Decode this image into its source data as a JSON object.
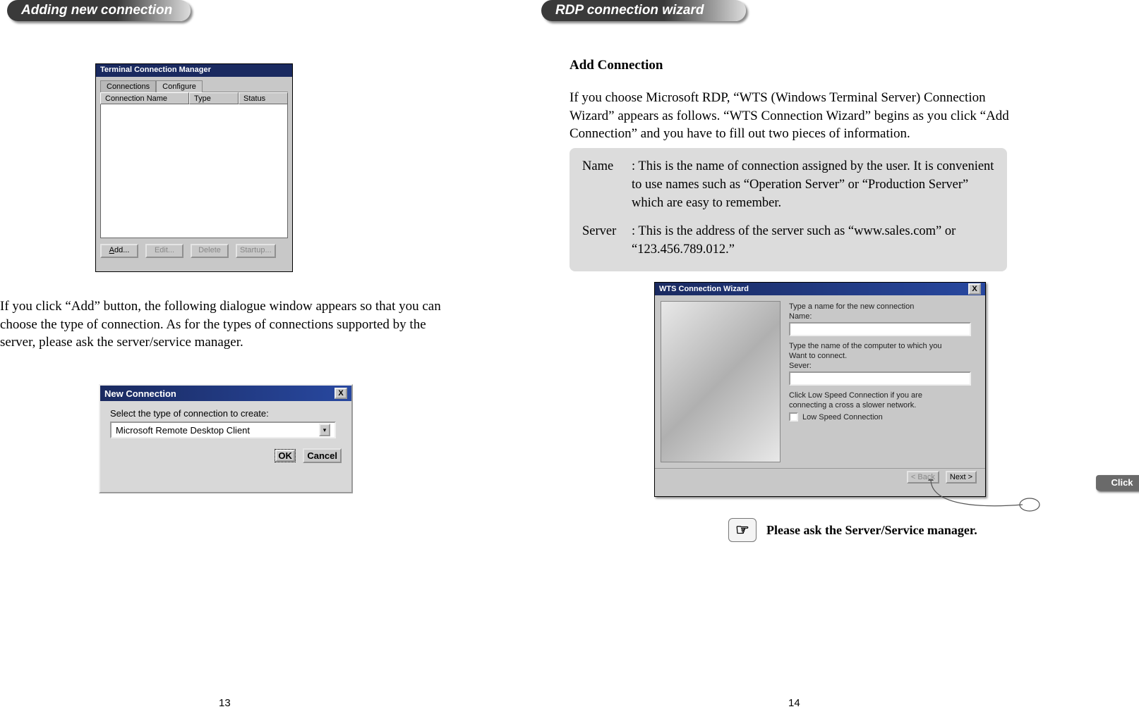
{
  "left": {
    "section_title": "Adding new connection",
    "tcm": {
      "title": "Terminal Connection Manager",
      "tabs": {
        "connections": "Connections",
        "configure": "Configure"
      },
      "cols": {
        "name": "Connection Name",
        "type": "Type",
        "status": "Status"
      },
      "buttons": {
        "add": "Add...",
        "edit": "Edit...",
        "delete": "Delete",
        "startup": "Startup..."
      }
    },
    "para1": "If you click “Add” button, the following dialogue window appears so that you can choose the type of connection. As for the types of connections supported by the server, please ask the server/service manager.",
    "nc": {
      "title": "New Connection",
      "prompt": "Select the type of connection to create:",
      "option": "Microsoft Remote Desktop Client",
      "ok": "OK",
      "cancel": "Cancel"
    },
    "page_num": "13"
  },
  "right": {
    "section_title": "RDP connection wizard",
    "heading": "Add Connection",
    "para1": "If you choose Microsoft RDP, “WTS (Windows Terminal Server) Connection Wizard” appears as follows. “WTS Connection Wizard” begins as you click “Add Connection” and you have to fill out two pieces of information.",
    "info": {
      "name_label": "Name",
      "name_text": ": This is the name of connection assigned by the user. It is convenient to use names such as “Operation Server” or “Production Server” which are easy to remember.",
      "server_label": "Server",
      "server_text": ": This is the address of the server such as “www.sales.com”  or “123.456.789.012.”"
    },
    "wts": {
      "title": "WTS Connection Wizard",
      "l1": "Type a name for the new connection",
      "l2": "Name:",
      "l3": "Type the name of the computer to which you",
      "l4": "Want to connect.",
      "l5": "Sever:",
      "l6": "Click Low Speed Connection if you are",
      "l7": "connecting a cross a slower network.",
      "low": "Low Speed Connection",
      "back": "< Back",
      "next": "Next >"
    },
    "click_label": "Click",
    "note": "Please ask the Server/Service manager.",
    "page_num": "14"
  }
}
